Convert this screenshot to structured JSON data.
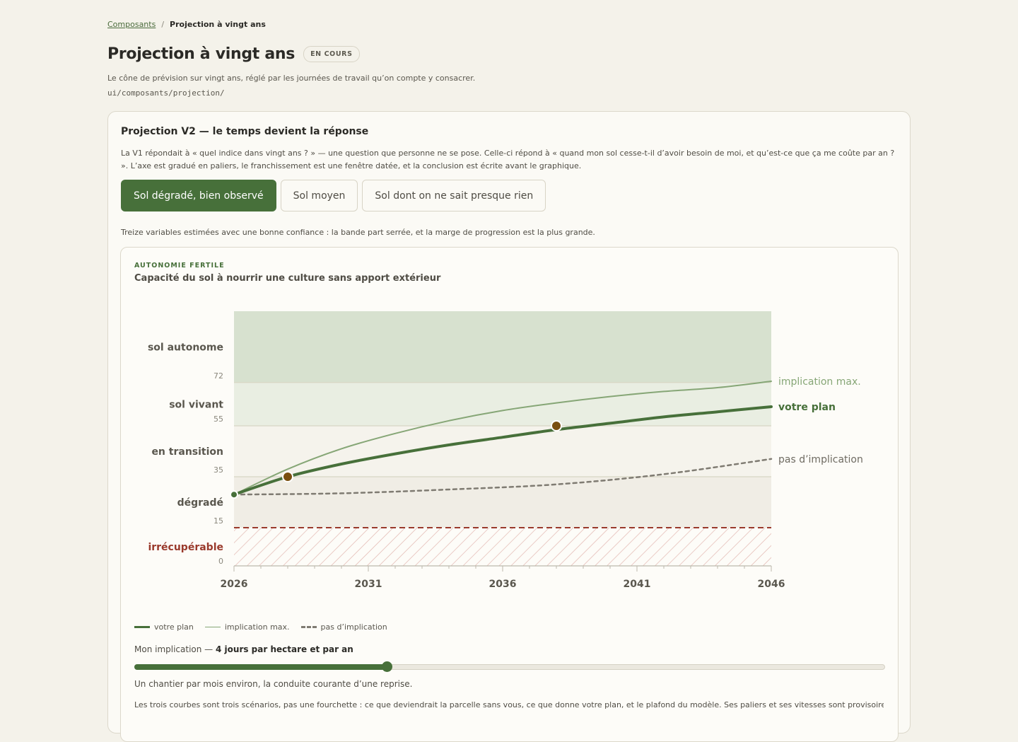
{
  "breadcrumb": {
    "parent": "Composants",
    "separator": "/",
    "current": "Projection à vingt ans"
  },
  "header": {
    "title": "Projection à vingt ans",
    "badge": "EN COURS",
    "description": "Le cône de prévision sur vingt ans, réglé par les journées de travail qu’on compte y consacrer.",
    "path": "ui/composants/projection/"
  },
  "card": {
    "title": "Projection V2 — le temps devient la réponse",
    "intro": "La V1 répondait à « quel indice dans vingt ans ? » — une question que personne ne se pose. Celle-ci répond à « quand mon sol cesse-t-il d’avoir besoin de moi, et qu’est-ce que ça me coûte par an ? ». L’axe est gradué en paliers, le franchissement est une fenêtre datée, et la conclusion est écrite avant le graphique.",
    "tabs": [
      {
        "label": "Sol dégradé, bien observé",
        "active": true
      },
      {
        "label": "Sol moyen",
        "active": false
      },
      {
        "label": "Sol dont on ne sait presque rien",
        "active": false
      }
    ],
    "scenario_note": "Treize variables estimées avec une bonne confiance : la bande part serrée, et la marge de progression est la plus grande."
  },
  "chart_panel": {
    "eyebrow": "AUTONOMIE FERTILE",
    "title": "Capacité du sol à nourrir une culture sans apport extérieur"
  },
  "chart_data": {
    "type": "line",
    "xlim": [
      2026,
      2046
    ],
    "ylim": [
      0,
      100
    ],
    "x_ticks": [
      2026,
      2031,
      2036,
      2041,
      2046
    ],
    "y_ticks": [
      0,
      15,
      35,
      55,
      72
    ],
    "bands": [
      {
        "label": "irrécupérable",
        "from": 0,
        "to": 15,
        "color": "#9a3a2c",
        "hatched": true
      },
      {
        "label": "dégradé",
        "from": 15,
        "to": 35,
        "color": "#f0ede5"
      },
      {
        "label": "en transition",
        "from": 35,
        "to": 55,
        "color": "#f5f3ec"
      },
      {
        "label": "sol vivant",
        "from": 55,
        "to": 72,
        "color": "#e9eee2"
      },
      {
        "label": "sol autonome",
        "from": 72,
        "to": 100,
        "color": "#d7e1cf"
      }
    ],
    "series": [
      {
        "name": "implication max.",
        "color": "#86a676",
        "style": "thin",
        "x": [
          2026,
          2028,
          2030,
          2032,
          2034,
          2036,
          2038,
          2040,
          2042,
          2044,
          2046
        ],
        "y": [
          28,
          38,
          46,
          52,
          57,
          61,
          64,
          66.5,
          68.5,
          70,
          72.5
        ]
      },
      {
        "name": "votre plan",
        "color": "#47703a",
        "style": "thick",
        "x": [
          2026,
          2028,
          2030,
          2032,
          2034,
          2036,
          2038,
          2040,
          2042,
          2044,
          2046
        ],
        "y": [
          28,
          35,
          40,
          44,
          47.5,
          50.5,
          53.5,
          56,
          58.5,
          60.5,
          62.5
        ]
      },
      {
        "name": "pas d’implication",
        "color": "#7f7b72",
        "style": "dashed",
        "x": [
          2026,
          2030,
          2034,
          2038,
          2042,
          2046
        ],
        "y": [
          28,
          28.5,
          30,
          32,
          36,
          42
        ]
      }
    ],
    "markers": [
      {
        "x": 2026,
        "y": 28,
        "color": "#47703a"
      },
      {
        "x": 2028,
        "y": 35,
        "color": "#7a4f10"
      },
      {
        "x": 2038,
        "y": 55,
        "color": "#7a4f10"
      }
    ]
  },
  "legend": [
    {
      "label": "votre plan",
      "key": "plan"
    },
    {
      "label": "implication max.",
      "key": "max"
    },
    {
      "label": "pas d’implication",
      "key": "none"
    }
  ],
  "slider": {
    "label": "Mon implication —",
    "value_text": "4 jours par hectare et par an",
    "fraction": 0.336,
    "hint": "Un chantier par mois environ, la conduite courante d’une reprise."
  },
  "footnote": "Les trois courbes sont trois scénarios, pas une fourchette : ce que deviendrait la parcelle sans vous, ce que donne votre plan, et le plafond du modèle. Ses paliers et ses vitesses sont provisoires et restent à"
}
